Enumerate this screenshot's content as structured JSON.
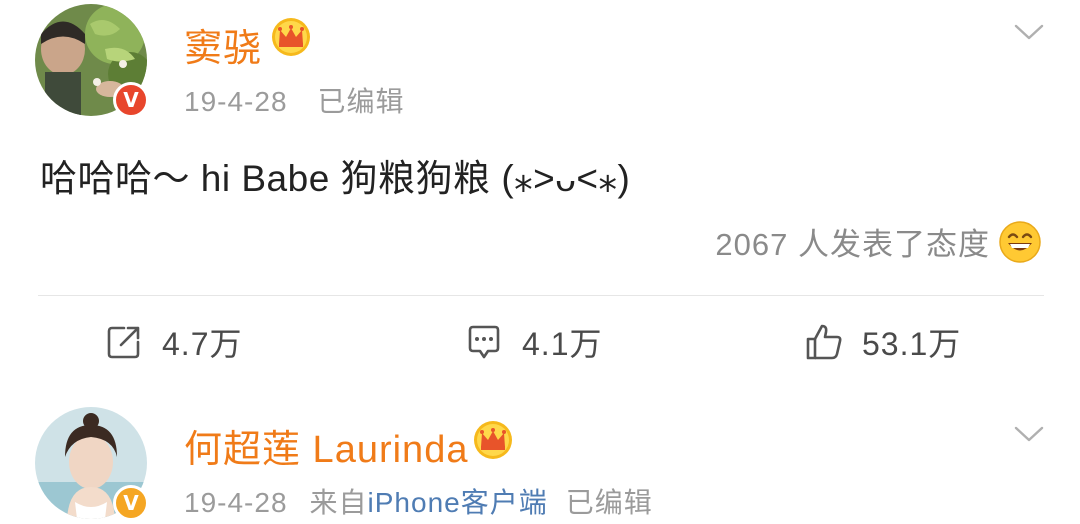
{
  "post": {
    "author": "窦骁",
    "date": "19-4-28",
    "edited": "已编辑",
    "text": "哈哈哈～ hi Babe 狗粮狗粮 (⁎˃ᴗ˂⁎)",
    "reactions_text": "2067 人发表了态度",
    "actions": {
      "repost_count": "4.7万",
      "comment_count": "4.1万",
      "like_count": "53.1万"
    },
    "icons": {
      "verified_badge": "V",
      "vip_crown": "crown-icon",
      "reaction_emoji": "grin-emoji-icon",
      "menu": "chevron-down-icon"
    }
  },
  "comment": {
    "author": "何超莲 Laurinda",
    "date": "19-4-28",
    "source_prefix": "来自",
    "source_device": "iPhone客户端",
    "edited": "已编辑",
    "verified_badge": "V"
  },
  "colors": {
    "username": "#f07b18",
    "meta": "#9b9b9b",
    "link": "#4f7cb3",
    "verified_red": "#e8462c",
    "verified_gold": "#f5a623"
  }
}
